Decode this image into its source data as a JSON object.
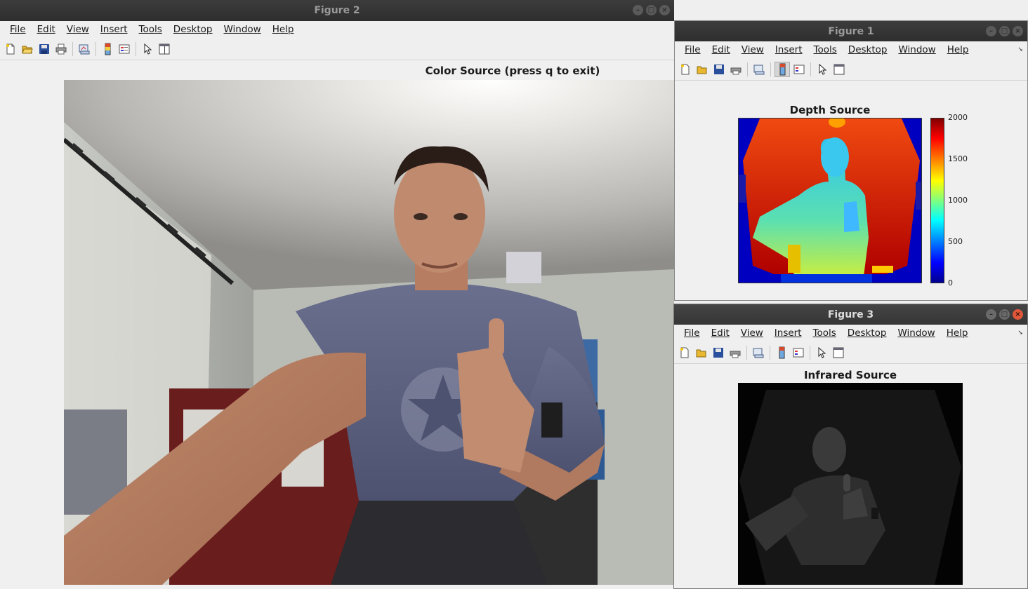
{
  "menu_labels": [
    "File",
    "Edit",
    "View",
    "Insert",
    "Tools",
    "Desktop",
    "Window",
    "Help"
  ],
  "figure2": {
    "window_title": "Figure 2",
    "axes_title": "Color Source (press q to exit)"
  },
  "figure1": {
    "window_title": "Figure 1",
    "axes_title": "Depth Source",
    "colorbar_ticks": [
      "2000",
      "1500",
      "1000",
      "500",
      "0"
    ]
  },
  "figure3": {
    "window_title": "Figure 3",
    "axes_title": "Infrared Source"
  },
  "icons": [
    "new-figure-icon",
    "open-file-icon",
    "save-icon",
    "print-icon",
    "link-plot-icon",
    "insert-colorbar-icon",
    "insert-legend-icon",
    "edit-plot-arrow-icon",
    "property-inspector-icon",
    "toolbar-overflow-chevron-icon"
  ],
  "colors": {
    "title_bar": "#353535",
    "close_button_active": "#e0573b",
    "window_bg": "#f0f0f0"
  }
}
